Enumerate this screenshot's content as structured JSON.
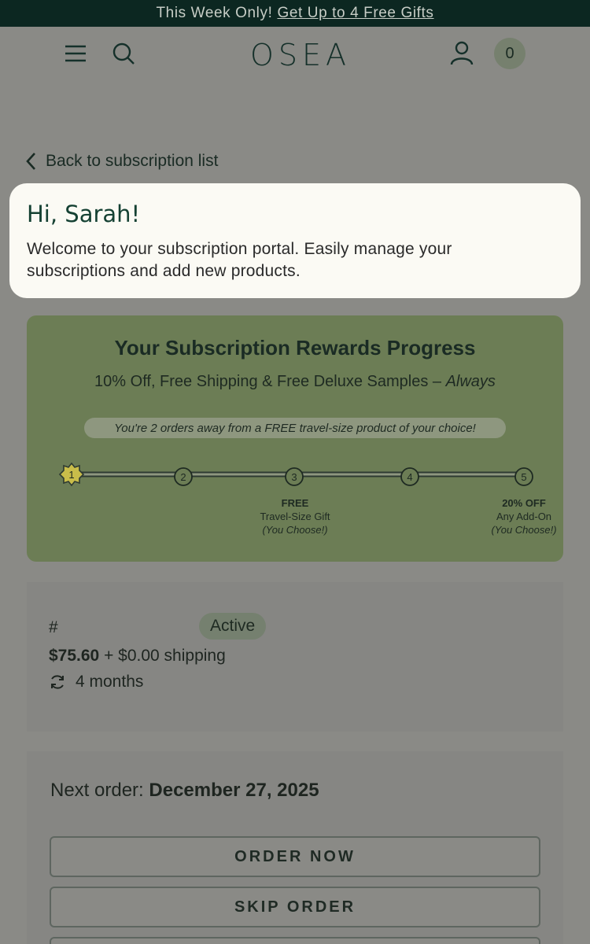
{
  "promo": {
    "text": "This Week Only!",
    "link": "Get Up to 4 Free Gifts"
  },
  "header": {
    "logo": "OSEA",
    "cart_count": "0"
  },
  "back_link": "Back to subscription list",
  "welcome": {
    "greeting": "Hi, Sarah!",
    "message_line1": "Welcome to your subscription portal. Easily manage your",
    "message_line2": "subscriptions and add new products."
  },
  "rewards": {
    "title": "Your Subscription Rewards Progress",
    "subtitle": "10% Off, Free Shipping & Free Deluxe Samples –",
    "subtitle_em": "Always",
    "progress_note": "You're 2 orders away from a FREE travel-size product of your choice!",
    "current_step": 1,
    "steps": [
      "1",
      "2",
      "3",
      "4",
      "5"
    ],
    "reward3": {
      "title": "FREE",
      "desc": "Travel-Size Gift",
      "note": "(You Choose!)"
    },
    "reward5": {
      "title": "20% OFF",
      "desc": "Any Add-On",
      "note": "(You Choose!)"
    }
  },
  "subscription": {
    "number": "#",
    "status": "Active",
    "price": "$75.60",
    "shipping": "+ $0.00 shipping",
    "frequency": "4 months"
  },
  "next_order": {
    "label": "Next order:",
    "date": "December 27, 2025",
    "order_now": "ORDER NOW",
    "skip_order": "SKIP ORDER"
  },
  "colors": {
    "banner": "#0c2721",
    "brand_green": "#154133",
    "card_highlight": "#fbfaf4",
    "rewards_bg": "#6c7d55"
  }
}
